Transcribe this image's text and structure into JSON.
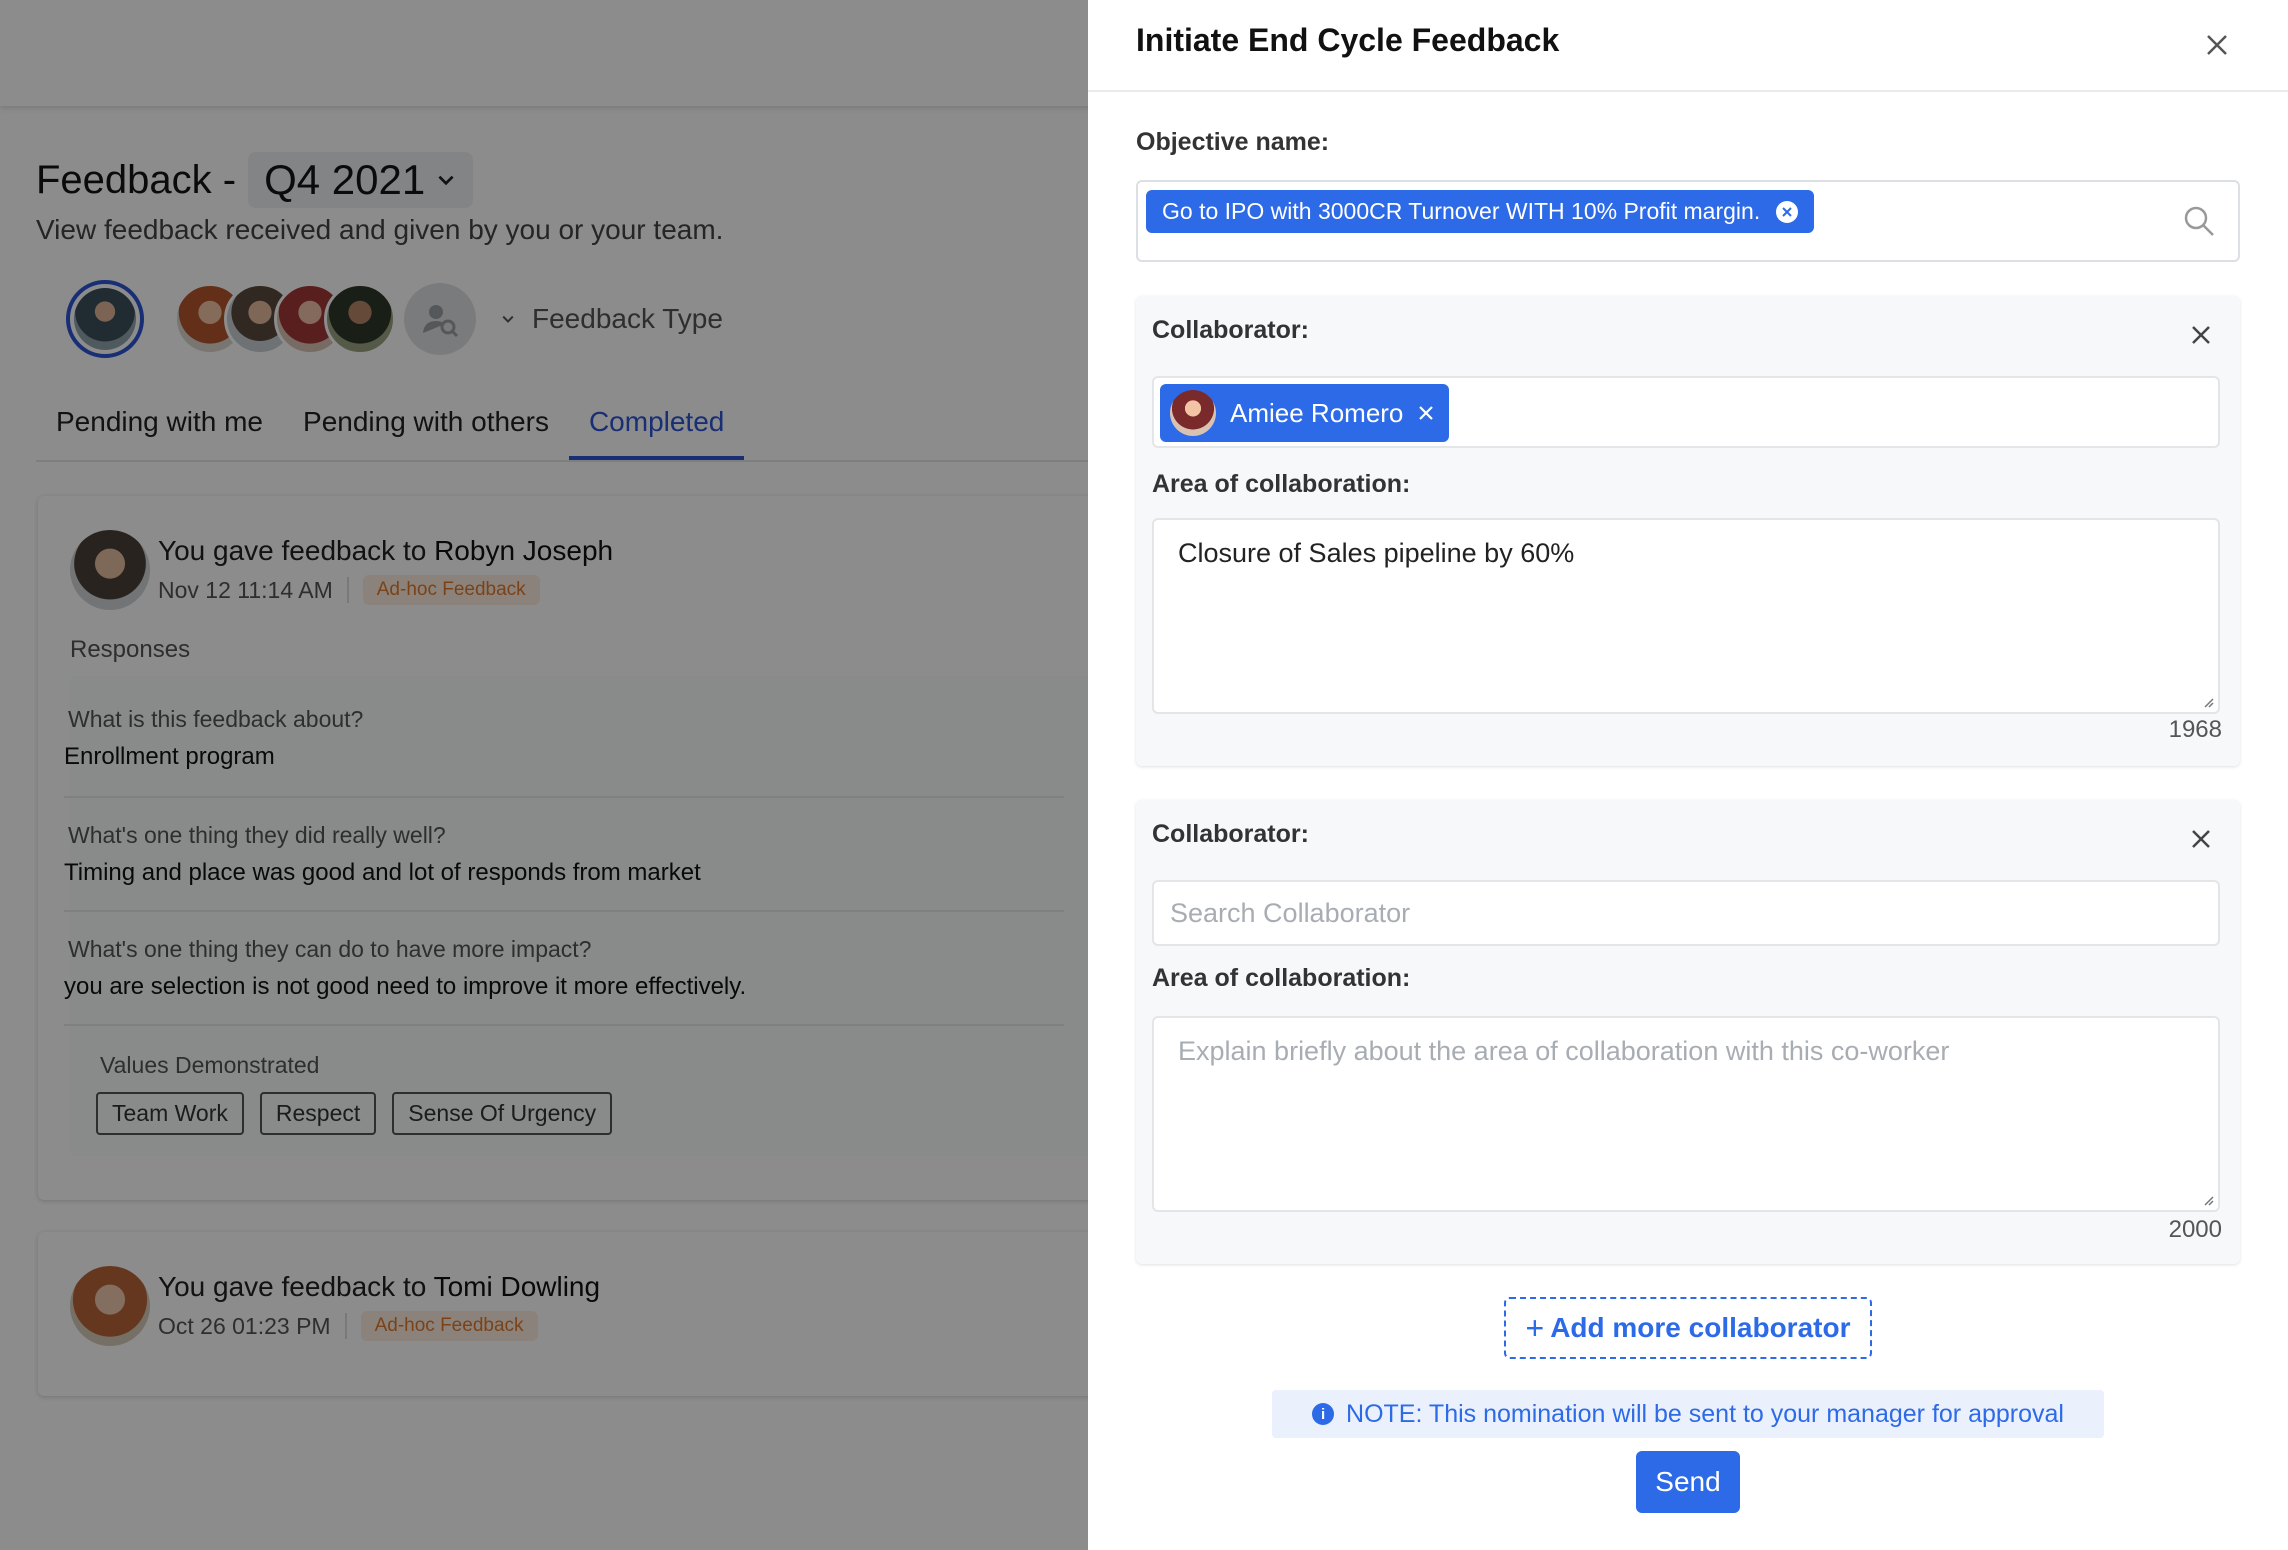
{
  "background": {
    "page_title": "Feedback -",
    "quarter": "Q4 2021",
    "subtitle": "View feedback received and given by you or your team.",
    "feedback_type_label": "Feedback Type",
    "tabs": [
      {
        "label": "Pending with me"
      },
      {
        "label": "Pending with others"
      },
      {
        "label": "Completed"
      }
    ],
    "cards": [
      {
        "prefix": "You gave feedback to ",
        "person": "Robyn Joseph",
        "date": "Nov 12 11:14 AM",
        "badge": "Ad-hoc Feedback",
        "responses_label": "Responses",
        "qa": [
          {
            "q": "What is this feedback about?",
            "a": "Enrollment program"
          },
          {
            "q": "What's one thing they did really well?",
            "a": "Timing and place was good and lot of responds from market"
          },
          {
            "q": "What's one thing they can do to have more impact?",
            "a": "you are selection is not good need to improve it more effectively."
          }
        ],
        "values_label": "Values Demonstrated",
        "values": [
          "Team Work",
          "Respect",
          "Sense Of Urgency"
        ]
      },
      {
        "prefix": "You gave feedback to ",
        "person": "Tomi Dowling",
        "date": "Oct 26 01:23 PM",
        "badge": "Ad-hoc Feedback"
      }
    ]
  },
  "drawer": {
    "title": "Initiate End Cycle Feedback",
    "objective_label": "Objective name:",
    "objective_tag": "Go to IPO with 3000CR Turnover WITH 10% Profit margin.",
    "collaborators": [
      {
        "label": "Collaborator:",
        "selected": "Amiee Romero",
        "area_label": "Area of collaboration:",
        "area_value": "Closure of Sales pipeline by 60%",
        "remaining": "1968"
      },
      {
        "label": "Collaborator:",
        "search_placeholder": "Search Collaborator",
        "area_label": "Area of collaboration:",
        "area_placeholder": "Explain briefly about the area of collaboration with this co-worker",
        "remaining": "2000"
      }
    ],
    "add_more_label": "Add more collaborator",
    "add_more_prefix": "+",
    "note": "NOTE: This nomination will be sent to your manager for approval",
    "send_label": "Send"
  },
  "colors": {
    "accent": "#2d6ae8",
    "tab_active": "#2d54d6",
    "badge_text": "#e0792c",
    "overlay": "rgba(0,0,0,0.45)"
  }
}
